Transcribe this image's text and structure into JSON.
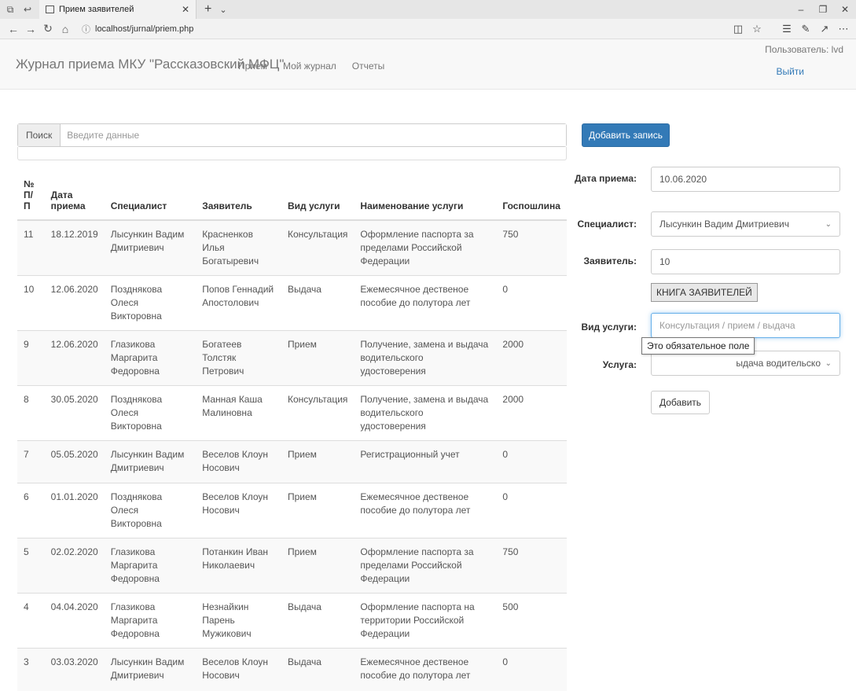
{
  "browser": {
    "tab_title": "Прием заявителей",
    "url": "localhost/jurnal/priem.php"
  },
  "navbar": {
    "brand": "Журнал приема МКУ \"Рассказовский МФЦ\"",
    "links": [
      "Прием",
      "Мой журнал",
      "Отчеты"
    ],
    "user_label": "Пользователь: lvd",
    "logout": "Выйти"
  },
  "search": {
    "label": "Поиск",
    "placeholder": "Введите данные"
  },
  "table": {
    "headers": [
      "№ П/П",
      "Дата приема",
      "Специалист",
      "Заявитель",
      "Вид услуги",
      "Наименование услуги",
      "Госпошлина"
    ],
    "rows": [
      [
        "11",
        "18.12.2019",
        "Лысункин Вадим Дмитриевич",
        "Красненков Илья Богатыревич",
        "Консультация",
        "Оформление паспорта за пределами Российской Федерации",
        "750"
      ],
      [
        "10",
        "12.06.2020",
        "Позднякова Олеся Викторовна",
        "Попов Геннадий Апостолович",
        "Выдача",
        "Ежемесячное дественое пособие до полутора лет",
        "0"
      ],
      [
        "9",
        "12.06.2020",
        "Глазикова Маргарита Федоровна",
        "Богатеев Толстяк Петрович",
        "Прием",
        "Получение, замена и выдача водительского удостоверения",
        "2000"
      ],
      [
        "8",
        "30.05.2020",
        "Позднякова Олеся Викторовна",
        "Манная Каша Малиновна",
        "Консультация",
        "Получение, замена и выдача водительского удостоверения",
        "2000"
      ],
      [
        "7",
        "05.05.2020",
        "Лысункин Вадим Дмитриевич",
        "Веселов Клоун Носович",
        "Прием",
        "Регистрационный учет",
        "0"
      ],
      [
        "6",
        "01.01.2020",
        "Позднякова Олеся Викторовна",
        "Веселов Клоун Носович",
        "Прием",
        "Ежемесячное дественое пособие до полутора лет",
        "0"
      ],
      [
        "5",
        "02.02.2020",
        "Глазикова Маргарита Федоровна",
        "Потанкин Иван Николаевич",
        "Прием",
        "Оформление паспорта за пределами Российской Федерации",
        "750"
      ],
      [
        "4",
        "04.04.2020",
        "Глазикова Маргарита Федоровна",
        "Незнайкин Парень Мужикович",
        "Выдача",
        "Оформление паспорта на территории Российской Федерации",
        "500"
      ],
      [
        "3",
        "03.03.2020",
        "Лысункин Вадим Дмитриевич",
        "Веселов Клоун Носович",
        "Выдача",
        "Ежемесячное дественое пособие до полутора лет",
        "0"
      ]
    ]
  },
  "form": {
    "add_record_button": "Добавить запись",
    "date_label": "Дата приема:",
    "date_value": "10.06.2020",
    "specialist_label": "Специалист:",
    "specialist_value": "Лысункин Вадим Дмитриевич",
    "applicant_label": "Заявитель:",
    "applicant_value": "10",
    "applicants_book_button": "КНИГА ЗАЯВИТЕЛЕЙ",
    "service_type_label": "Вид услуги:",
    "service_type_placeholder": "Консультация / прием / выдача",
    "required_tooltip": "Это обязательное поле",
    "service_label": "Услуга:",
    "service_value_visible": "ыдача водительско",
    "submit_button": "Добавить"
  }
}
